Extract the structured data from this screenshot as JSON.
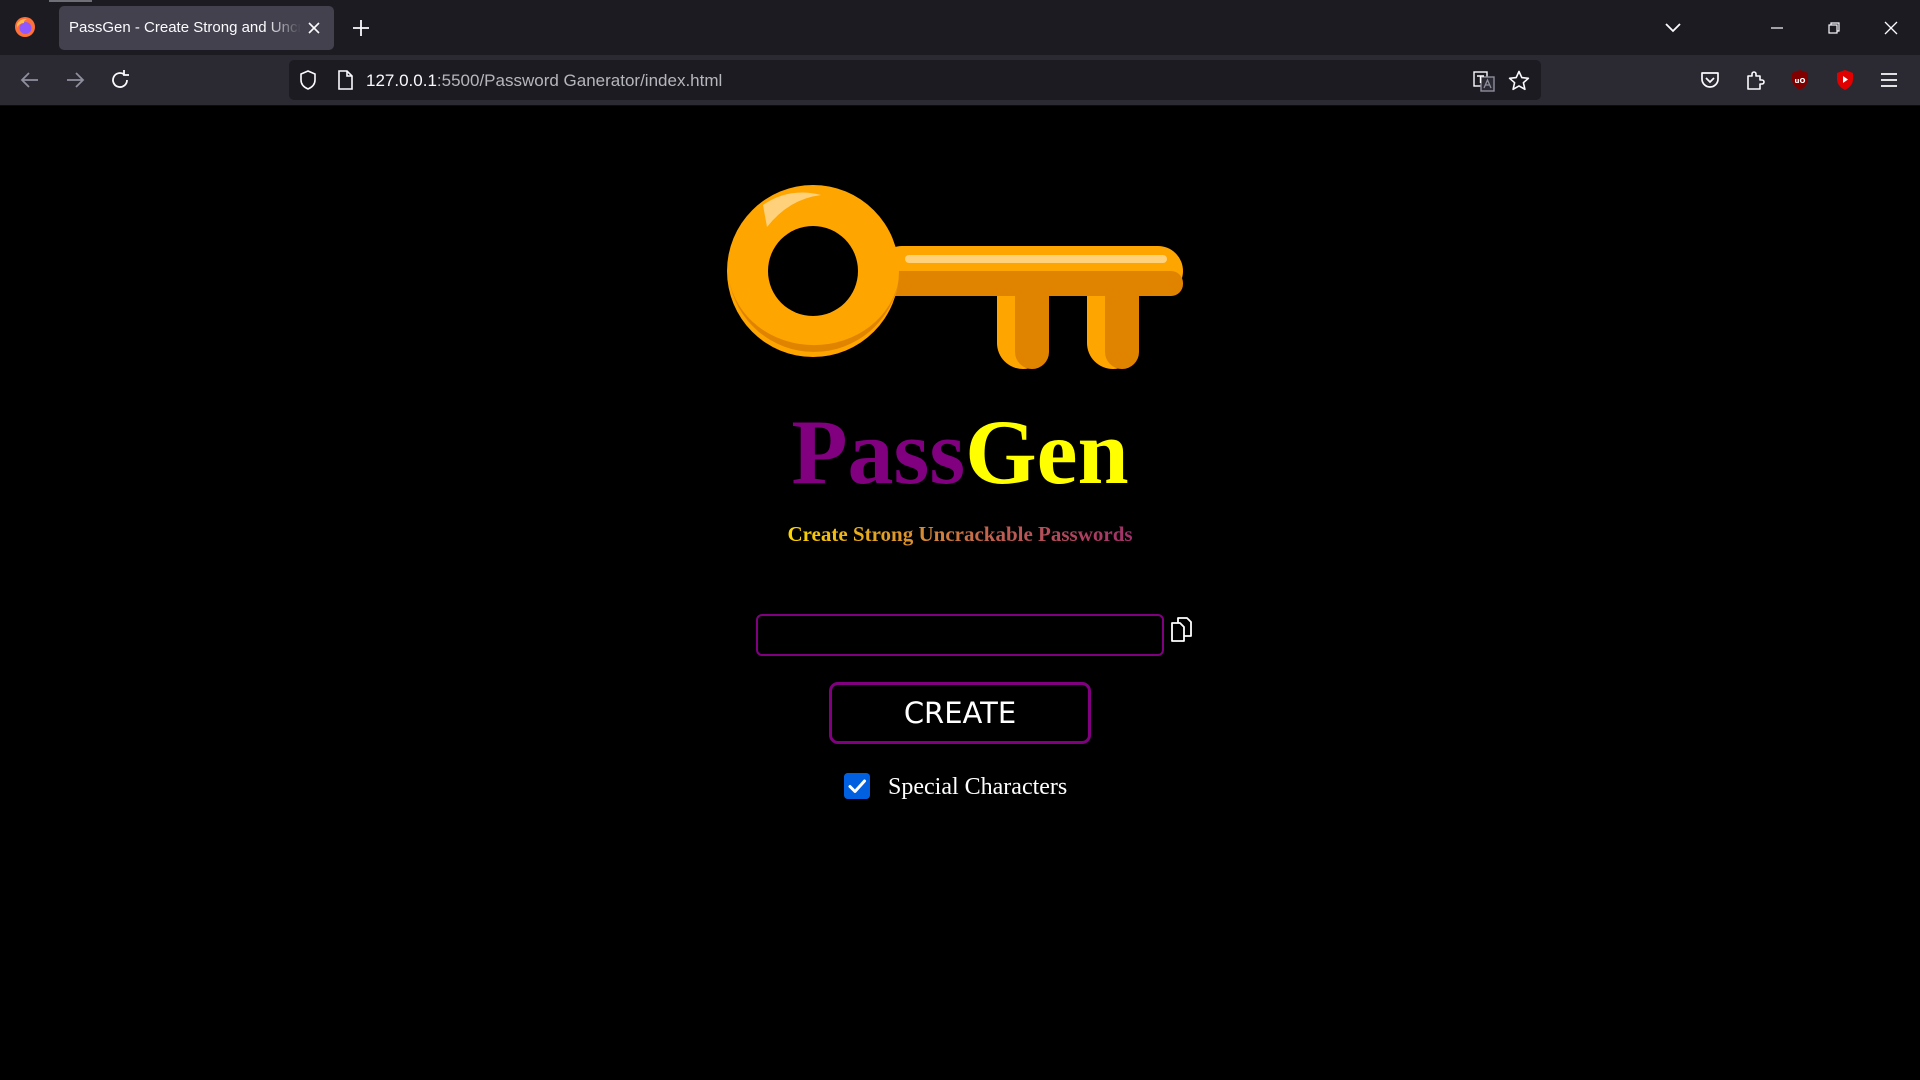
{
  "browser": {
    "tab_title": "PassGen - Create Strong and Uncrackable Passwords",
    "url_host": "127.0.0.1",
    "url_rest": ":5500/Password Ganerator/index.html",
    "icons": [
      "firefox-logo",
      "close-icon",
      "plus-icon",
      "chevron-down-icon",
      "minimize-icon",
      "restore-icon",
      "close-window-icon",
      "back-arrow-icon",
      "forward-arrow-icon",
      "reload-icon",
      "shield-icon",
      "page-icon",
      "translate-icon",
      "star-icon",
      "pocket-icon",
      "extensions-icon",
      "ublock-icon",
      "youtube-icon",
      "hamburger-menu-icon"
    ]
  },
  "app": {
    "brand_part1": "Pass",
    "brand_part2": "Gen",
    "tagline": "Create Strong Uncrackable Passwords",
    "password_value": "",
    "create_label": "CREATE",
    "special_chars_label": "Special Characters",
    "special_chars_checked": true,
    "colors": {
      "brand_purple": "#800080",
      "brand_yellow": "#ffff00",
      "key_orange": "#ffa500",
      "checkbox_blue": "#0060df",
      "background": "#000000"
    }
  }
}
